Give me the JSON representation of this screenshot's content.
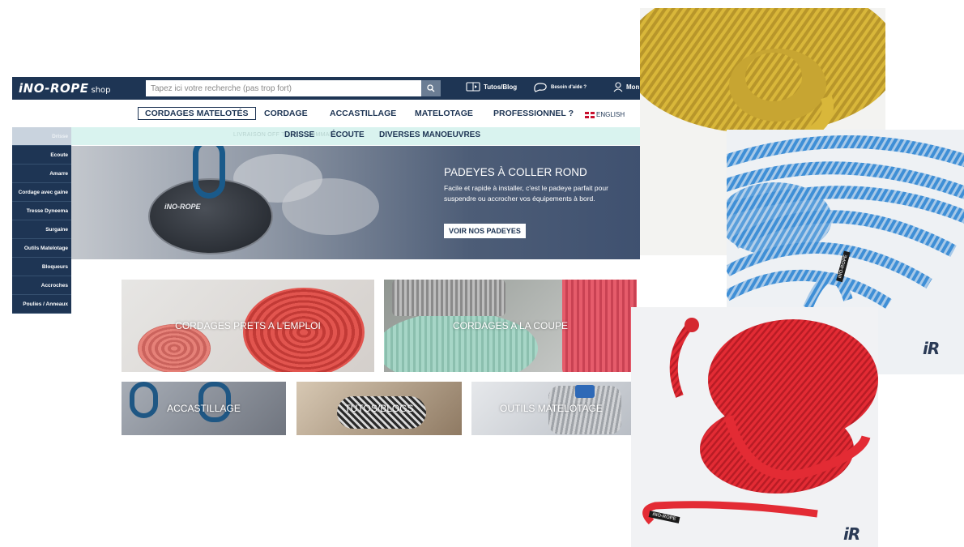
{
  "header": {
    "logo": "iNO-ROPE",
    "logo_suffix": "shop",
    "search_placeholder": "Tapez ici votre recherche (pas trop fort)",
    "tutos": "Tutos/Blog",
    "help": "Besoin d'aide ?",
    "account": "Mon"
  },
  "nav": {
    "items": [
      "CORDAGES MATELOTÉS",
      "CORDAGE",
      "ACCASTILLAGE",
      "MATELOTAGE",
      "PROFESSIONNEL ?"
    ],
    "language": "ENGLISH"
  },
  "promo": {
    "text": "LIVRAISON OFF          TH                    IE                  IE COMMANDE"
  },
  "submenu": [
    "DRISSE",
    "ÉCOUTE",
    "DIVERSES MANOEUVRES"
  ],
  "sidebar": {
    "items": [
      "Drisse",
      "Ecoute",
      "Amarre",
      "Cordage avec gaine",
      "Tresse Dyneema",
      "Surgaine",
      "Outils Matelotage",
      "Bloqueurs",
      "Accroches",
      "Poulies / Anneaux"
    ]
  },
  "hero": {
    "title": "PADEYES À COLLER ROND",
    "description": "Facile et rapide à installer, c'est le padeye parfait pour suspendre ou accrocher vos équipements à bord.",
    "button": "VOIR NOS PADEYES",
    "disc_text": "iNO-ROPE"
  },
  "tiles": [
    "CORDAGES PRETS A L'EMPLOI",
    "CORDAGES A LA COUPE",
    "ACCASTILLAGE",
    "TUTOS/BLOGS",
    "OUTILS MATELOTAGE"
  ],
  "photos": {
    "blue_label": "iNO-ROPE",
    "blue_logo": "iR",
    "red_label": "iNO-ROPE",
    "red_logo": "iR"
  },
  "colors": {
    "navy": "#1e3554",
    "promo": "#d9f3ef",
    "rope_yellow": "#d9b73a",
    "rope_blue": "#3f8fd6",
    "rope_red": "#e32b34"
  }
}
